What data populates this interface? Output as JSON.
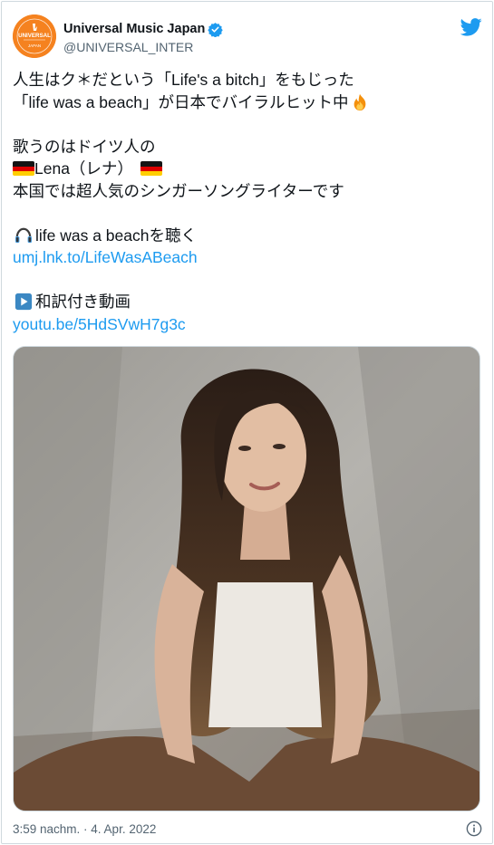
{
  "tweet": {
    "author": {
      "display_name": "Universal Music Japan",
      "handle": "@UNIVERSAL_INTER",
      "verified": true,
      "avatar_text_top": "UNIVERSAL",
      "avatar_text_bottom": "JAPAN"
    },
    "lines": {
      "l1": "人生はク＊だという「Life's a bitch」をもじった",
      "l2": "「life was a beach」が日本でバイラルヒット中",
      "l3": "歌うのはドイツ人の",
      "l4": "Lena（レナ）",
      "l5": "本国では超人気のシンガーソングライターです",
      "l6": "life was a beachを聴く",
      "l7_link": "umj.lnk.to/LifeWasABeach",
      "l8": "和訳付き動画",
      "l9_link": "youtu.be/5HdSVwH7g3c"
    },
    "timestamp": "3:59 nachm. · 4. Apr. 2022",
    "icons": {
      "brand": "twitter-bird-icon",
      "verified": "verified-badge-icon",
      "fire": "fire-emoji-icon",
      "flag": "german-flag-emoji-icon",
      "headphone": "headphone-emoji-icon",
      "play": "play-button-emoji-icon",
      "info": "info-icon"
    },
    "colors": {
      "link": "#1d9bf0",
      "text": "#0f1419",
      "muted": "#536471",
      "avatar": "#f5821f",
      "twitter_blue": "#1d9bf0"
    }
  }
}
